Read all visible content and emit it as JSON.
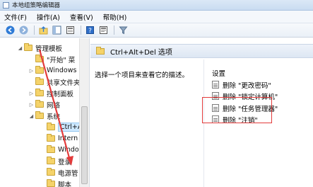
{
  "window": {
    "title": "本地组策略编辑器"
  },
  "menu": {
    "file": "文件(F)",
    "action": "操作(A)",
    "view": "查看(V)",
    "help": "帮助(H)"
  },
  "toolbar": {
    "icons": [
      "back-icon",
      "forward-icon",
      "up-folder-icon",
      "show-hide-tree-icon",
      "export-icon",
      "help-icon",
      "properties-icon",
      "filter-icon"
    ]
  },
  "tree": {
    "items": [
      {
        "label": "管理模板"
      },
      {
        "label": "\"开始\" 菜"
      },
      {
        "label": "Windows"
      },
      {
        "label": "共享文件夹"
      },
      {
        "label": "控制面板"
      },
      {
        "label": "网络"
      },
      {
        "label": "系统"
      },
      {
        "label": "Ctrl+Al"
      },
      {
        "label": "Intern"
      },
      {
        "label": "Windo"
      },
      {
        "label": "登录"
      },
      {
        "label": "电源管"
      },
      {
        "label": "脚本"
      }
    ]
  },
  "content": {
    "header_title": "Ctrl+Alt+Del 选项",
    "description_prompt": "选择一个项目来查看它的描述。",
    "column_header": "设置",
    "settings": [
      {
        "label": "删除 \"更改密码\""
      },
      {
        "label": "删除 \"锁定计算机\""
      },
      {
        "label": "删除 \"任务管理器\""
      },
      {
        "label": "删除 \"注销\""
      }
    ]
  },
  "colors": {
    "highlight_outline": "#e33b3b",
    "selection_fill": "#cde8ff"
  }
}
